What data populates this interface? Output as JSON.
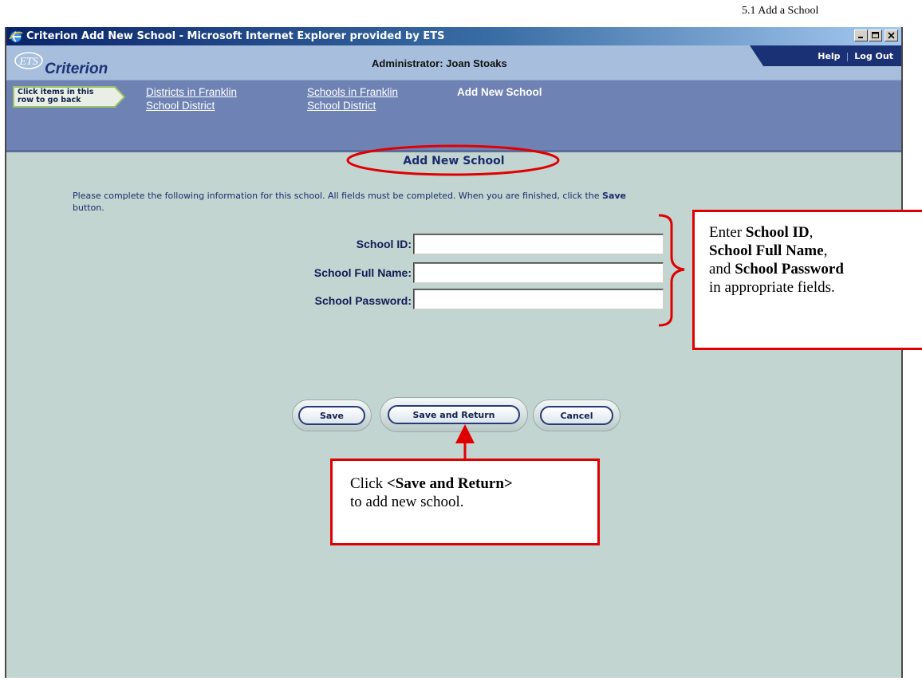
{
  "page_caption": "5.1 Add a School",
  "window": {
    "title": "Criterion Add New School - Microsoft Internet Explorer provided by ETS",
    "icons": {
      "app": "ie-icon",
      "minimize": "minimize-icon",
      "maximize": "maximize-icon",
      "close": "close-icon"
    }
  },
  "header": {
    "logo_mark": "ETS",
    "logo_text": "Criterion",
    "admin_label": "Administrator: Joan Stoaks",
    "help_label": "Help",
    "separator": "|",
    "logout_label": "Log Out"
  },
  "breadcrumb": {
    "back_hint_line1": "Click items in this",
    "back_hint_line2": "row to go back",
    "items": [
      {
        "line1": "Districts in Franklin",
        "line2": "School District"
      },
      {
        "line1": "Schools in Franklin",
        "line2": "School District"
      },
      {
        "line1": "Add New School"
      }
    ]
  },
  "main": {
    "heading": "Add New School",
    "instructions_text": "Please complete the following information for this school. All fields must be completed. When you are finished, click the ",
    "instructions_bold": "Save",
    "instructions_end": " button.",
    "fields": [
      {
        "label": "School ID:",
        "value": ""
      },
      {
        "label": "School Full Name:",
        "value": ""
      },
      {
        "label": "School Password:",
        "value": ""
      }
    ],
    "buttons": {
      "save": "Save",
      "save_return": "Save and Return",
      "cancel": "Cancel"
    }
  },
  "annotations": {
    "fields_callout": {
      "t1": "Enter ",
      "b1": "School ID",
      "t2": ",",
      "b2": "School Full Name",
      "t3": ",",
      "t4": "and ",
      "b3": "School Password",
      "t5": "in appropriate fields."
    },
    "button_callout": {
      "t1": "Click ",
      "b1": "<Save and Return>",
      "t2": "to add new school."
    },
    "accent_color": "#e00000"
  }
}
